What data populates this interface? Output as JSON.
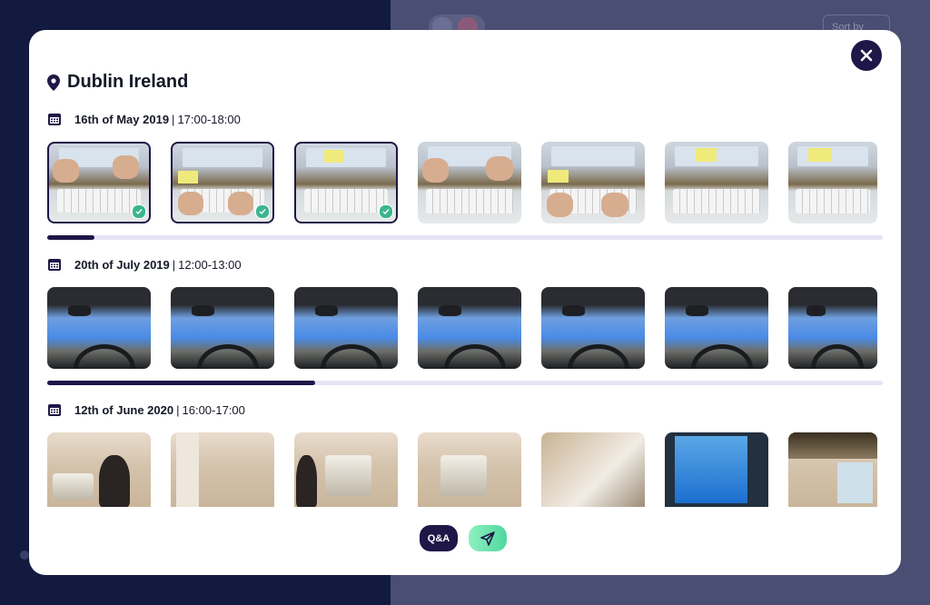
{
  "background": {
    "sort_label": "Sort by"
  },
  "modal": {
    "title": "Dublin Ireland",
    "qa_label": "Q&A",
    "accent": "#1e1747",
    "send_gradient": [
      "#8ef0c0",
      "#4fd79e"
    ]
  },
  "sections": [
    {
      "date": "16th of May 2019",
      "time": "17:00-18:00",
      "progress": 0.057,
      "thumbnails": [
        {
          "scene": "desk-keyboard-hands",
          "selected": true
        },
        {
          "scene": "desk-keyboard-hands-note",
          "selected": true
        },
        {
          "scene": "desk-keyboard-note",
          "selected": true
        },
        {
          "scene": "desk-keyboard-hands",
          "selected": false
        },
        {
          "scene": "desk-keyboard-hands-note",
          "selected": false
        },
        {
          "scene": "desk-keyboard-note",
          "selected": false
        },
        {
          "scene": "desk-keyboard-note",
          "selected": false
        }
      ]
    },
    {
      "date": "20th of July 2019",
      "time": "12:00-13:00",
      "progress": 0.321,
      "thumbnails": [
        {
          "scene": "car-windshield",
          "selected": false
        },
        {
          "scene": "car-windshield",
          "selected": false
        },
        {
          "scene": "car-windshield",
          "selected": false
        },
        {
          "scene": "car-windshield",
          "selected": false
        },
        {
          "scene": "car-windshield",
          "selected": false
        },
        {
          "scene": "car-windshield",
          "selected": false
        },
        {
          "scene": "car-windshield",
          "selected": false
        }
      ]
    },
    {
      "date": "12th of June 2020",
      "time": "16:00-17:00",
      "thumbnails": [
        {
          "scene": "room-person",
          "selected": false
        },
        {
          "scene": "room-door",
          "selected": false
        },
        {
          "scene": "room-shelf",
          "selected": false
        },
        {
          "scene": "room-shelf",
          "selected": false
        },
        {
          "scene": "room-corner",
          "selected": false
        },
        {
          "scene": "room-blue",
          "selected": false
        },
        {
          "scene": "room-window-lights",
          "selected": false
        }
      ]
    }
  ]
}
